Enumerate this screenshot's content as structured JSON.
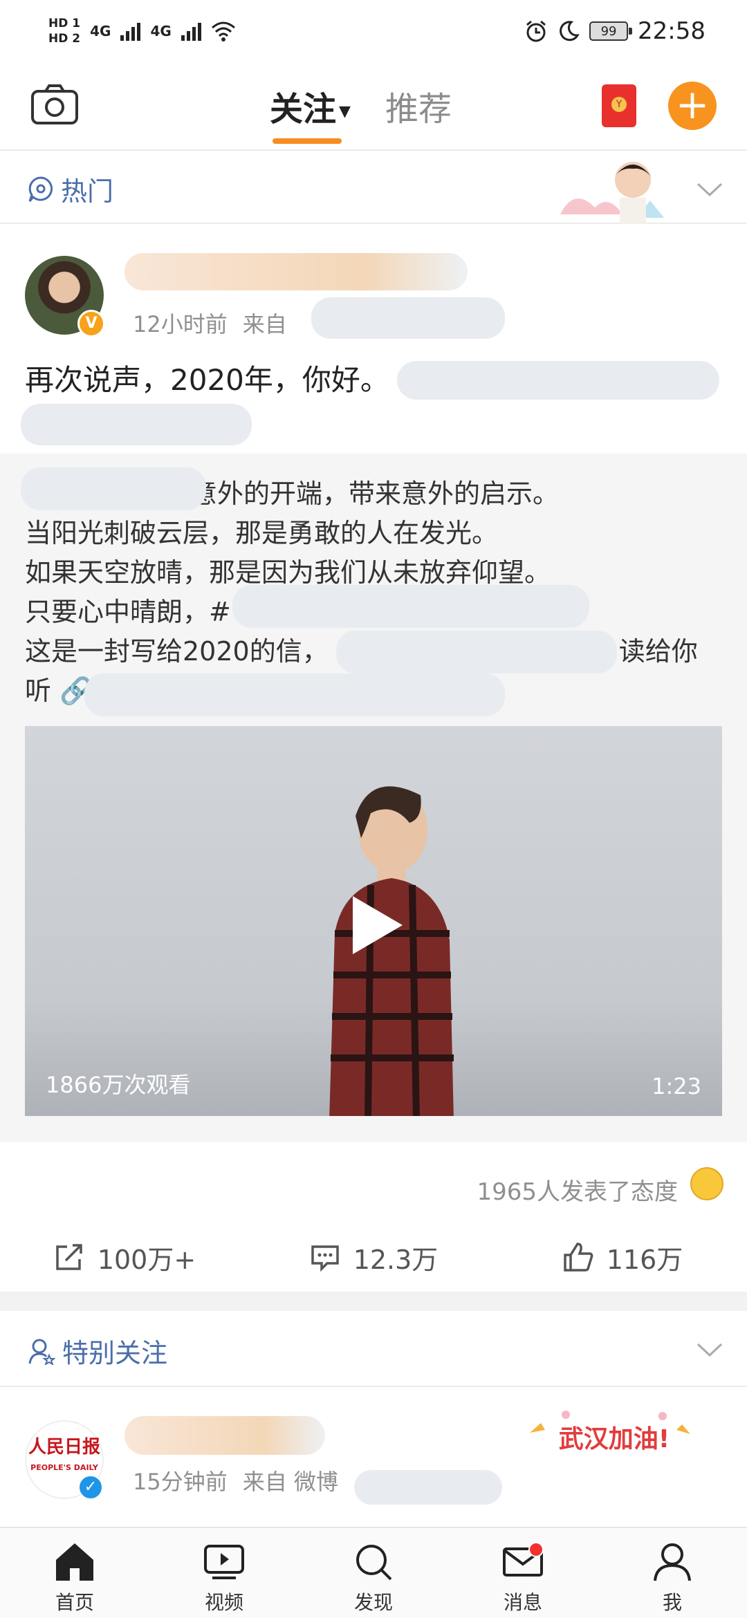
{
  "status_bar": {
    "hd_labels": [
      "HD",
      "HD"
    ],
    "sim_numbers": [
      "1",
      "2"
    ],
    "network_labels": [
      "4G",
      "4G"
    ],
    "battery": "99",
    "time": "22:58",
    "icons": [
      "alarm-icon",
      "moon-icon",
      "wifi-icon"
    ]
  },
  "header": {
    "tabs": [
      {
        "label": "关注",
        "active": true
      },
      {
        "label": "推荐",
        "active": false
      }
    ],
    "accent_color": "#f78d21"
  },
  "hot_section": {
    "label": "热门"
  },
  "post": {
    "meta_time": "12小时前",
    "meta_source": "来自",
    "text": "再次说声，2020年，你好。",
    "repost_lines": [
      "意外的开端，带来意外的启示。",
      "当阳光刺破云层，那是勇敢的人在发光。",
      "如果天空放晴，那是因为我们从未放弃仰望。",
      "只要心中晴朗，#",
      "这是一封写给2020的信，",
      "读给你",
      "听"
    ],
    "video": {
      "views": "1866万次观看",
      "duration": "1:23"
    },
    "attitude_text": "1965人发表了态度",
    "actions": {
      "repost": "100万+",
      "comment": "12.3万",
      "like": "116万"
    }
  },
  "special_section": {
    "label": "特别关注"
  },
  "post2": {
    "avatar_text": "人民日报",
    "avatar_subtext": "PEOPLE'S DAILY",
    "meta_time": "15分钟前",
    "meta_source": "来自 微博",
    "banner": "武汉加油!"
  },
  "bottom_nav": [
    {
      "label": "首页",
      "icon": "home-icon"
    },
    {
      "label": "视频",
      "icon": "video-icon"
    },
    {
      "label": "发现",
      "icon": "search-icon"
    },
    {
      "label": "消息",
      "icon": "mail-icon"
    },
    {
      "label": "我",
      "icon": "profile-icon"
    }
  ]
}
